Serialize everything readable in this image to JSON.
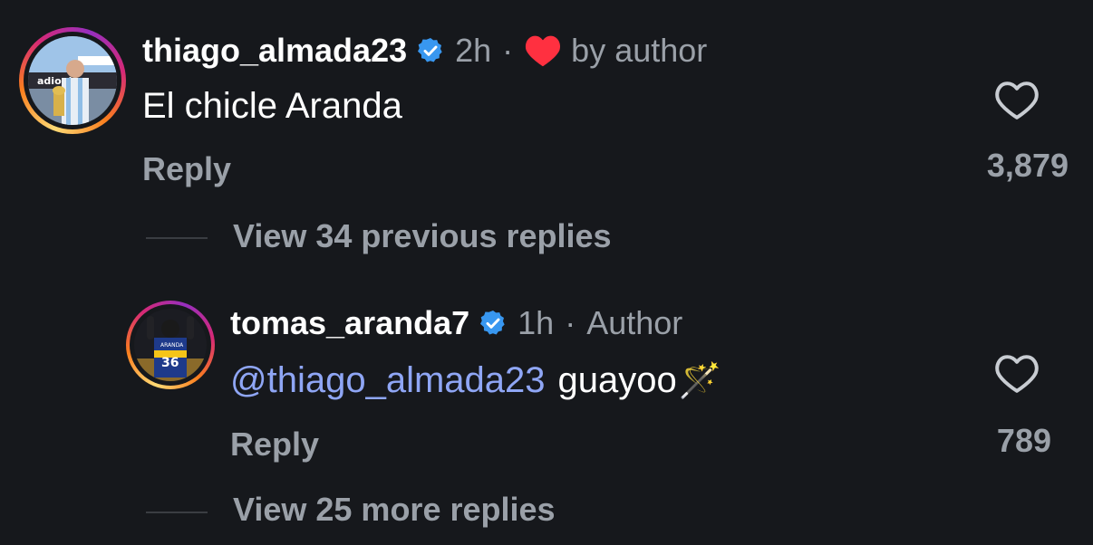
{
  "colors": {
    "background": "#16181c",
    "muted_text": "#9aa0a8",
    "mention": "#8fa6f5",
    "verified": "#3897f0",
    "heart_red": "#ff3040"
  },
  "comment1": {
    "username": "thiago_almada23",
    "time": "2h",
    "separator": "·",
    "liked_by": "by author",
    "text": "El chicle Aranda",
    "reply_label": "Reply",
    "like_count": "3,879",
    "icons": [
      "avatar",
      "verified-badge-icon",
      "red-heart-icon",
      "heart-outline-icon"
    ]
  },
  "view_previous": {
    "label": "View 34 previous replies"
  },
  "comment2": {
    "username": "tomas_aranda7",
    "time": "1h",
    "separator": "·",
    "author_tag": "Author",
    "mention": "@thiago_almada23",
    "text": "guayoo",
    "emoji": "🪄",
    "reply_label": "Reply",
    "like_count": "789",
    "icons": [
      "avatar",
      "verified-badge-icon",
      "heart-outline-icon",
      "magic-wand-emoji"
    ]
  },
  "view_more": {
    "label": "View 25 more replies"
  }
}
